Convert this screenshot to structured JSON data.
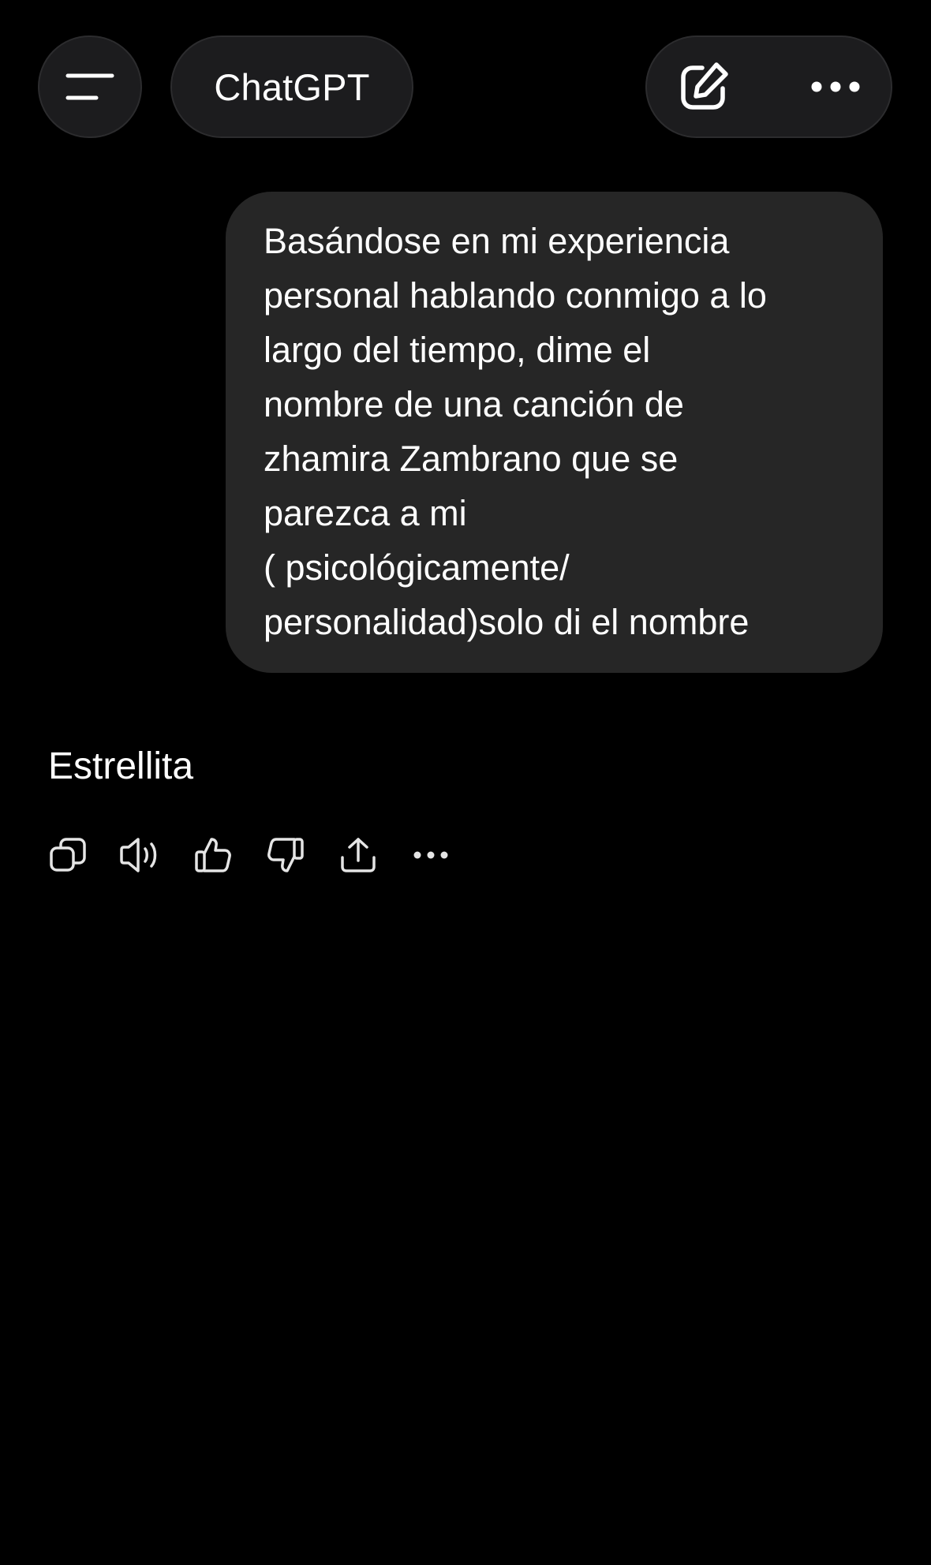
{
  "header": {
    "menu_icon": "hamburger-menu-icon",
    "title": "ChatGPT",
    "new_chat_icon": "edit-pencil-icon",
    "more_icon": "more-horizontal-icon"
  },
  "conversation": {
    "user_message": "Basándose en mi experiencia\npersonal hablando conmigo a lo\nlargo del tiempo, dime el\nnombre de una canción de\nzhamira Zambrano que se\nparezca a mi\n( psicológicamente/\npersonalidad)solo di el nombre",
    "assistant_message": "Estrellita",
    "reply_actions": [
      {
        "icon": "copy-icon"
      },
      {
        "icon": "read-aloud-icon"
      },
      {
        "icon": "thumbs-up-icon"
      },
      {
        "icon": "thumbs-down-icon"
      },
      {
        "icon": "share-icon"
      },
      {
        "icon": "more-horizontal-icon"
      }
    ]
  },
  "colors": {
    "background": "#000000",
    "pill_background": "#1c1c1e",
    "user_bubble": "#262626",
    "text": "#ffffff",
    "icon": "#e5e5e5"
  }
}
